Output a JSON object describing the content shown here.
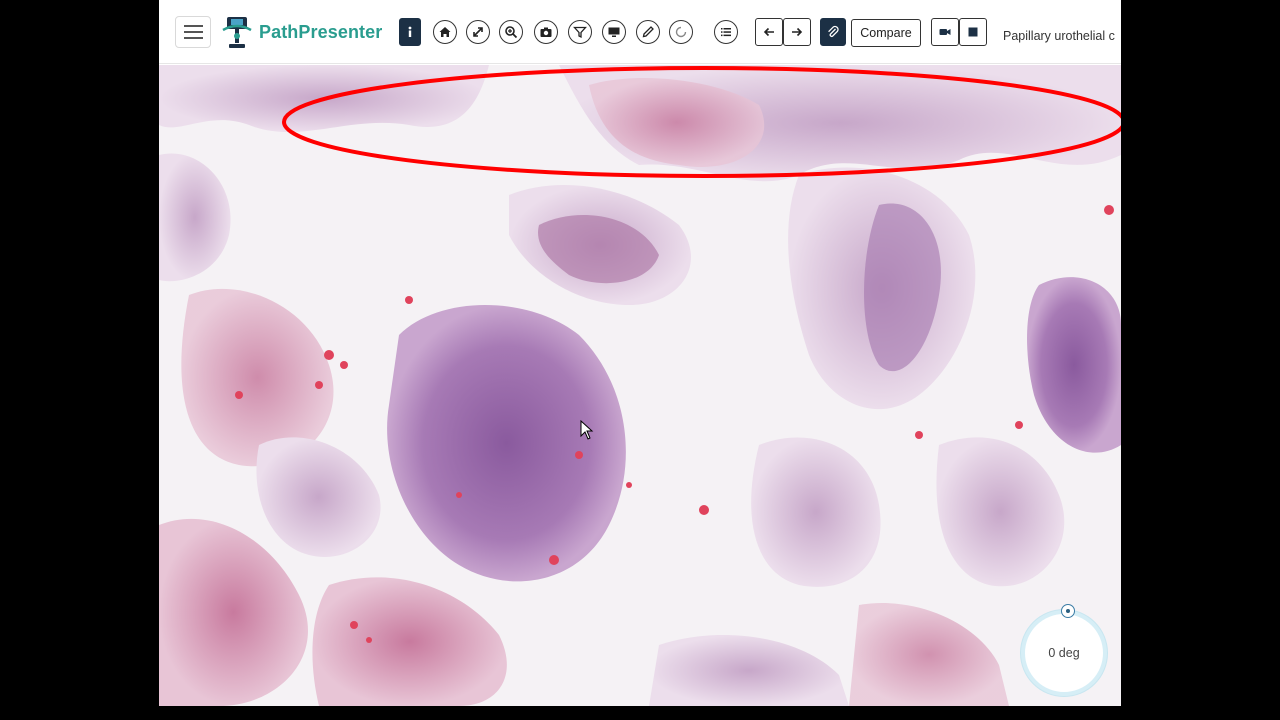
{
  "app": {
    "brand_name": "PathPresenter",
    "slide_title": "Papillary urothelial c",
    "accent_color": "#2a9d8f",
    "toolbar_dark_color": "#1c3045"
  },
  "toolbar": {
    "menu_icon": "hamburger-icon",
    "info_icon": "info-icon",
    "tools": [
      {
        "name": "home",
        "icon": "home-icon"
      },
      {
        "name": "fullscreen",
        "icon": "expand-arrows-icon"
      },
      {
        "name": "zoom",
        "icon": "zoom-in-icon"
      },
      {
        "name": "snapshot",
        "icon": "camera-icon"
      },
      {
        "name": "filter",
        "icon": "filter-icon"
      },
      {
        "name": "present",
        "icon": "monitor-icon"
      },
      {
        "name": "annotate",
        "icon": "pencil-icon"
      },
      {
        "name": "rotate",
        "icon": "rotate-icon"
      },
      {
        "name": "list",
        "icon": "list-icon"
      },
      {
        "name": "previous",
        "icon": "arrow-left-icon"
      },
      {
        "name": "next",
        "icon": "arrow-right-icon"
      },
      {
        "name": "attach",
        "icon": "paperclip-icon"
      },
      {
        "name": "record",
        "icon": "video-camera-icon"
      },
      {
        "name": "stop",
        "icon": "stop-icon"
      }
    ],
    "compare_label": "Compare"
  },
  "viewer": {
    "annotation_color": "#ff0000",
    "rotation_label": "0 deg"
  }
}
